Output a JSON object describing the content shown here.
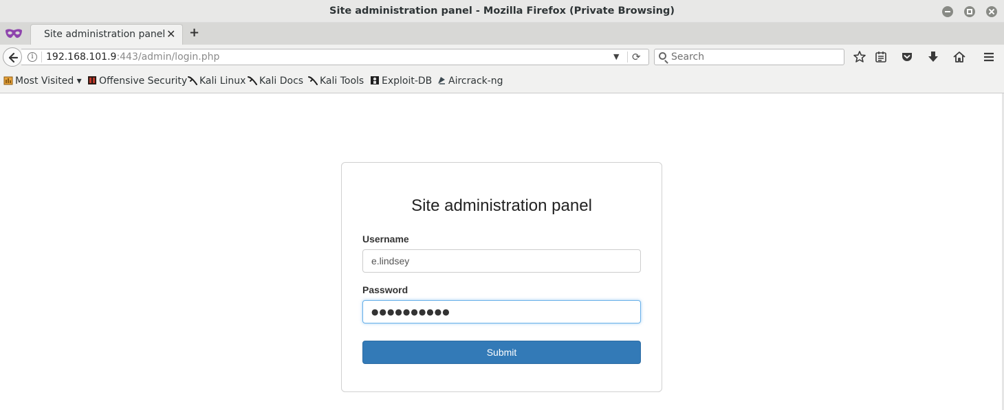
{
  "window": {
    "title": "Site administration panel - Mozilla Firefox (Private Browsing)"
  },
  "tabs": [
    {
      "label": "Site administration panel",
      "close": "✕"
    }
  ],
  "newtab": "+",
  "navbar": {
    "url_host": "192.168.101.9",
    "url_path": ":443/admin/login.php",
    "dropdown": "▼",
    "reload": "⟳",
    "search_placeholder": "Search",
    "toolbar_icons": [
      "star-icon",
      "reading-list-icon",
      "pocket-icon",
      "download-icon",
      "home-icon",
      "menu-icon"
    ]
  },
  "bookmarks": [
    {
      "label": "Most Visited ▾",
      "icon": "most-visited-icon"
    },
    {
      "label": "Offensive Security",
      "icon": "offsec-icon"
    },
    {
      "label": "Kali Linux",
      "icon": "kali-dragon-icon"
    },
    {
      "label": "Kali Docs",
      "icon": "kali-dragon-icon"
    },
    {
      "label": "Kali Tools",
      "icon": "kali-dragon-icon"
    },
    {
      "label": "Exploit-DB",
      "icon": "exploit-db-icon"
    },
    {
      "label": "Aircrack-ng",
      "icon": "aircrack-icon"
    }
  ],
  "form": {
    "heading": "Site administration panel",
    "username_label": "Username",
    "username_value": "e.lindsey",
    "password_label": "Password",
    "password_mask": "●●●●●●●●●●",
    "submit_label": "Submit"
  },
  "colors": {
    "primary_button": "#337ab7",
    "focus_border": "#66afe9"
  }
}
